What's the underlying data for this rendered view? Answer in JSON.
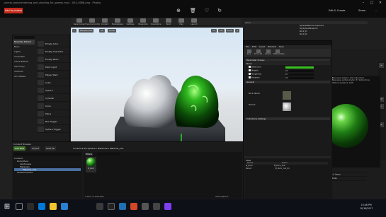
{
  "photos": {
    "title": "_unreal_tools/rendering_and_shading_for_games.mp4 - UE4_0068.png - Photos",
    "badge": "Add to photos",
    "tools": [
      {
        "icon": "zoom-in-icon",
        "glyph": "⊕"
      },
      {
        "icon": "trash-icon",
        "glyph": "🗑"
      },
      {
        "icon": "heart-icon",
        "glyph": "♡"
      },
      {
        "icon": "rotate-icon",
        "glyph": "↻"
      },
      {
        "icon": "crop-icon",
        "glyph": "⌗"
      }
    ],
    "edit_create": "Edit & Create",
    "share": "Share",
    "more": "...",
    "window_controls": [
      "–",
      "□",
      "✕"
    ]
  },
  "ue": {
    "toolbar": [
      {
        "label": "Save Current"
      },
      {
        "label": "Source Control"
      },
      {
        "label": "Content"
      },
      {
        "label": "Marketplace"
      },
      {
        "label": "Settings"
      },
      {
        "label": "Blueprints"
      },
      {
        "label": "Cinematics"
      },
      {
        "label": "Build"
      },
      {
        "label": "Play"
      },
      {
        "label": "Launch"
      }
    ],
    "modes": {
      "categories": [
        "Recently Placed",
        "Basic",
        "Lights",
        "Cinematic",
        "Visual Effects",
        "Geometry",
        "Volumes",
        "All Classes"
      ],
      "items": [
        "Empty Actor",
        "Empty Character",
        "Empty Pawn",
        "Point Light",
        "Player Start",
        "Cube",
        "Sphere",
        "Cylinder",
        "Cone",
        "Plane",
        "Box Trigger",
        "Sphere Trigger"
      ]
    },
    "viewport": {
      "buttons": [
        "Perspective",
        "Lit",
        "Show"
      ],
      "right_buttons": [
        "10",
        "10°",
        "0.25",
        "4"
      ],
      "stats": [
        "",
        ""
      ]
    },
    "content_browser": {
      "tab": "Content Browser",
      "add_new": "Add New",
      "import": "Import",
      "save_all": "Save All",
      "path": [
        "Content",
        "RockyHere",
        "Materials",
        "Material_Inst"
      ],
      "tree": [
        "Content",
        "RockyHere",
        "Landscape",
        "Materials",
        "Material_Inst",
        "StarterContent"
      ],
      "filters": "Filters",
      "asset_name": "M_Rock",
      "count": "1 item (1 selected)",
      "view_options": "View Options"
    },
    "outliner": {
      "header": "Label",
      "rows": [
        "SphereReflectionCapture3",
        "SkySphereBlueprint",
        "Rock_01",
        "Rock_02"
      ]
    },
    "details_rows": [
      "Transform",
      "Location",
      "Rotation",
      "Scale",
      "Materials",
      "Element 0",
      "Physics",
      "Collision",
      "Lighting",
      "Rendering",
      "Actor Hidden In Game",
      "Editor Billboard Scale"
    ]
  },
  "material_editor": {
    "menu": [
      "File",
      "Edit",
      "Asset",
      "Window",
      "Help"
    ],
    "toolbar": [
      "Save",
      "Find in CB",
      "Params",
      "Platform Stats"
    ],
    "sections": [
      "Parameter Groups",
      "None",
      "General",
      "Collections Settings"
    ],
    "rows": [
      "Base Color",
      "Metallic",
      "Roughness",
      "Emissive"
    ],
    "values": [
      "",
      "0.0",
      "0.7",
      "0.0"
    ],
    "texture_label": "Rock Albedo",
    "normal_label": "Normal",
    "preview_tag": "Viewport",
    "preview_stats": [
      "Base pass shader: 131 instructions",
      "Base pass vertex shader: 37 instructions",
      "Texture samplers: 4/16"
    ],
    "stats_head": "Stats",
    "stats_cols": [
      "Parent",
      "Name"
    ],
    "stats_vals": [
      "M_Rock",
      "M_Rock_Inst",
      "Parent",
      "M_Rock_Inst_01"
    ]
  },
  "rendering_panel": [
    "Rendering",
    "Actor Hidden In Game",
    "Editor Billboard Scale"
  ],
  "taskbar": {
    "time": "10:46 PM",
    "date": "10/18/2017"
  }
}
